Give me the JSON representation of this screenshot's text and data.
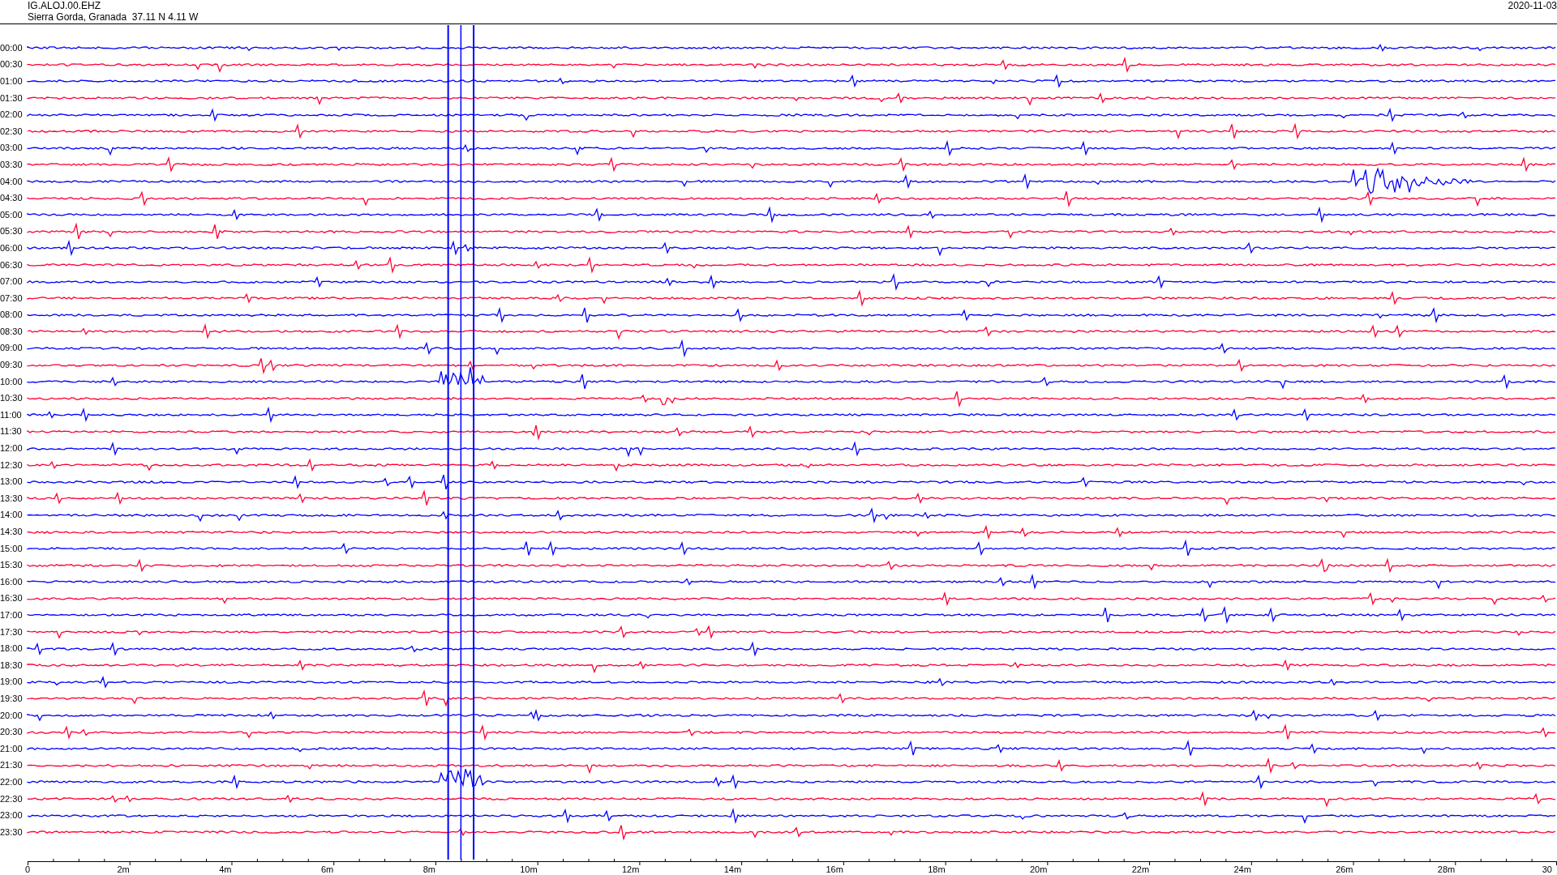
{
  "header": {
    "station": "IG.ALOJ.00.EHZ",
    "location": "Sierra Gorda, Granada  37.11 N 4.11 W",
    "date": "2020-11-03"
  },
  "rows": [
    {
      "label": "00:00",
      "color": "#0000ff"
    },
    {
      "label": "00:30",
      "color": "#ff0033"
    },
    {
      "label": "01:00",
      "color": "#0000ff"
    },
    {
      "label": "01:30",
      "color": "#ff0033"
    },
    {
      "label": "02:00",
      "color": "#0000ff"
    },
    {
      "label": "02:30",
      "color": "#ff0033"
    },
    {
      "label": "03:00",
      "color": "#0000ff"
    },
    {
      "label": "03:30",
      "color": "#ff0033"
    },
    {
      "label": "04:00",
      "color": "#0000ff"
    },
    {
      "label": "04:30",
      "color": "#ff0033"
    },
    {
      "label": "05:00",
      "color": "#0000ff"
    },
    {
      "label": "05:30",
      "color": "#ff0033"
    },
    {
      "label": "06:00",
      "color": "#0000ff"
    },
    {
      "label": "06:30",
      "color": "#ff0033"
    },
    {
      "label": "07:00",
      "color": "#0000ff"
    },
    {
      "label": "07:30",
      "color": "#ff0033"
    },
    {
      "label": "08:00",
      "color": "#0000ff"
    },
    {
      "label": "08:30",
      "color": "#ff0033"
    },
    {
      "label": "09:00",
      "color": "#0000ff"
    },
    {
      "label": "09:30",
      "color": "#ff0033"
    },
    {
      "label": "10:00",
      "color": "#0000ff"
    },
    {
      "label": "10:30",
      "color": "#ff0033"
    },
    {
      "label": "11:00",
      "color": "#0000ff"
    },
    {
      "label": "11:30",
      "color": "#ff0033"
    },
    {
      "label": "12:00",
      "color": "#0000ff"
    },
    {
      "label": "12:30",
      "color": "#ff0033"
    },
    {
      "label": "13:00",
      "color": "#0000ff"
    },
    {
      "label": "13:30",
      "color": "#ff0033"
    },
    {
      "label": "14:00",
      "color": "#0000ff"
    },
    {
      "label": "14:30",
      "color": "#ff0033"
    },
    {
      "label": "15:00",
      "color": "#0000ff"
    },
    {
      "label": "15:30",
      "color": "#ff0033"
    },
    {
      "label": "16:00",
      "color": "#0000ff"
    },
    {
      "label": "16:30",
      "color": "#ff0033"
    },
    {
      "label": "17:00",
      "color": "#0000ff"
    },
    {
      "label": "17:30",
      "color": "#ff0033"
    },
    {
      "label": "18:00",
      "color": "#0000ff"
    },
    {
      "label": "18:30",
      "color": "#ff0033"
    },
    {
      "label": "19:00",
      "color": "#0000ff"
    },
    {
      "label": "19:30",
      "color": "#ff0033"
    },
    {
      "label": "20:00",
      "color": "#0000ff"
    },
    {
      "label": "20:30",
      "color": "#ff0033"
    },
    {
      "label": "21:00",
      "color": "#0000ff"
    },
    {
      "label": "21:30",
      "color": "#ff0033"
    },
    {
      "label": "22:00",
      "color": "#0000ff"
    },
    {
      "label": "22:30",
      "color": "#ff0033"
    },
    {
      "label": "23:00",
      "color": "#0000ff"
    },
    {
      "label": "23:30",
      "color": "#ff0033"
    }
  ],
  "x_axis": {
    "labels": [
      "0",
      "2m",
      "4m",
      "6m",
      "8m",
      "10m",
      "12m",
      "14m",
      "16m",
      "18m",
      "20m",
      "22m",
      "24m",
      "26m",
      "28m",
      "30"
    ]
  }
}
